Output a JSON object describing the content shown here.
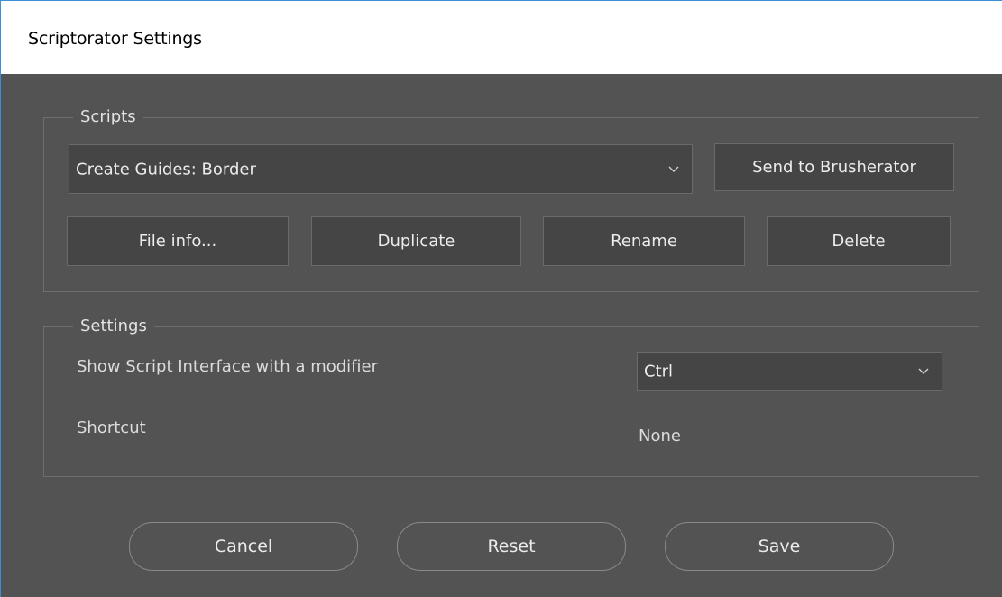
{
  "window": {
    "title": "Scriptorator Settings"
  },
  "scripts_group": {
    "legend": "Scripts",
    "script_select": {
      "value": "Create Guides: Border",
      "icon": "chevron-down-icon"
    },
    "send_button": "Send to Brusherator",
    "buttons": {
      "file_info": "File info...",
      "duplicate": "Duplicate",
      "rename": "Rename",
      "delete": "Delete"
    }
  },
  "settings_group": {
    "legend": "Settings",
    "modifier_label": "Show Script Interface with a modifier",
    "modifier_select": {
      "value": "Ctrl",
      "icon": "chevron-down-icon"
    },
    "shortcut_label": "Shortcut",
    "shortcut_value": "None"
  },
  "footer": {
    "cancel": "Cancel",
    "reset": "Reset",
    "save": "Save"
  },
  "colors": {
    "background": "#535353",
    "titlebar": "#ffffff",
    "control_bg": "#454545",
    "text": "#ececec",
    "accent_border": "#3a8fd6"
  }
}
